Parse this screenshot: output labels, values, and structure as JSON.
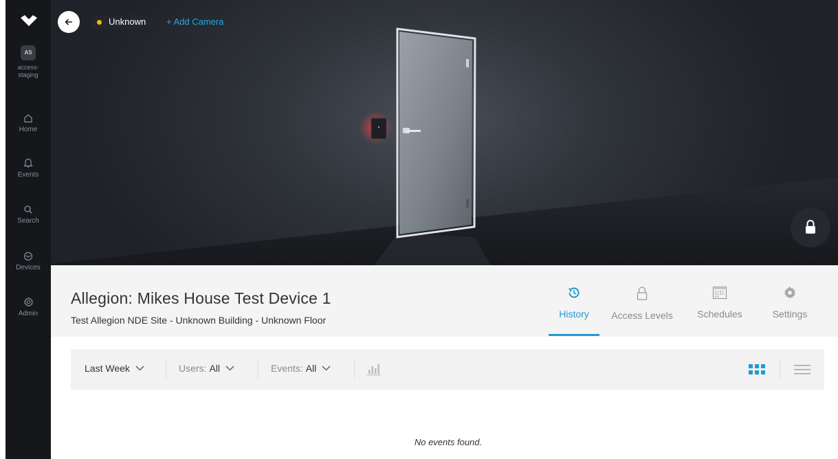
{
  "sidebar": {
    "org_initials": "AS",
    "org_name_line1": "access-",
    "org_name_line2": "staging",
    "items": [
      {
        "label": "Home",
        "icon": "home-icon"
      },
      {
        "label": "Events",
        "icon": "bell-icon"
      },
      {
        "label": "Search",
        "icon": "search-icon"
      },
      {
        "label": "Devices",
        "icon": "devices-icon"
      },
      {
        "label": "Admin",
        "icon": "gear-icon"
      }
    ]
  },
  "hero": {
    "status_label": "Unknown",
    "status_color": "#f0b90b",
    "add_camera_label": "+ Add Camera",
    "lock_icon": "lock-icon"
  },
  "device": {
    "title": "Allegion: Mikes House Test Device 1",
    "subtitle": "Test Allegion NDE Site - Unknown Building - Unknown Floor"
  },
  "tabs": [
    {
      "label": "History",
      "icon": "history-icon",
      "active": true
    },
    {
      "label": "Access Levels",
      "icon": "lock-outline-icon",
      "active": false
    },
    {
      "label": "Schedules",
      "icon": "calendar-icon",
      "active": false
    },
    {
      "label": "Settings",
      "icon": "gear-icon",
      "active": false
    }
  ],
  "filters": {
    "range": "Last Week",
    "users_label": "Users:",
    "users_value": "All",
    "events_label": "Events:",
    "events_value": "All"
  },
  "empty_message": "No events found.",
  "colors": {
    "accent": "#1f9ad6",
    "sidebar_bg": "#16171b",
    "status_unknown": "#f0b90b"
  }
}
